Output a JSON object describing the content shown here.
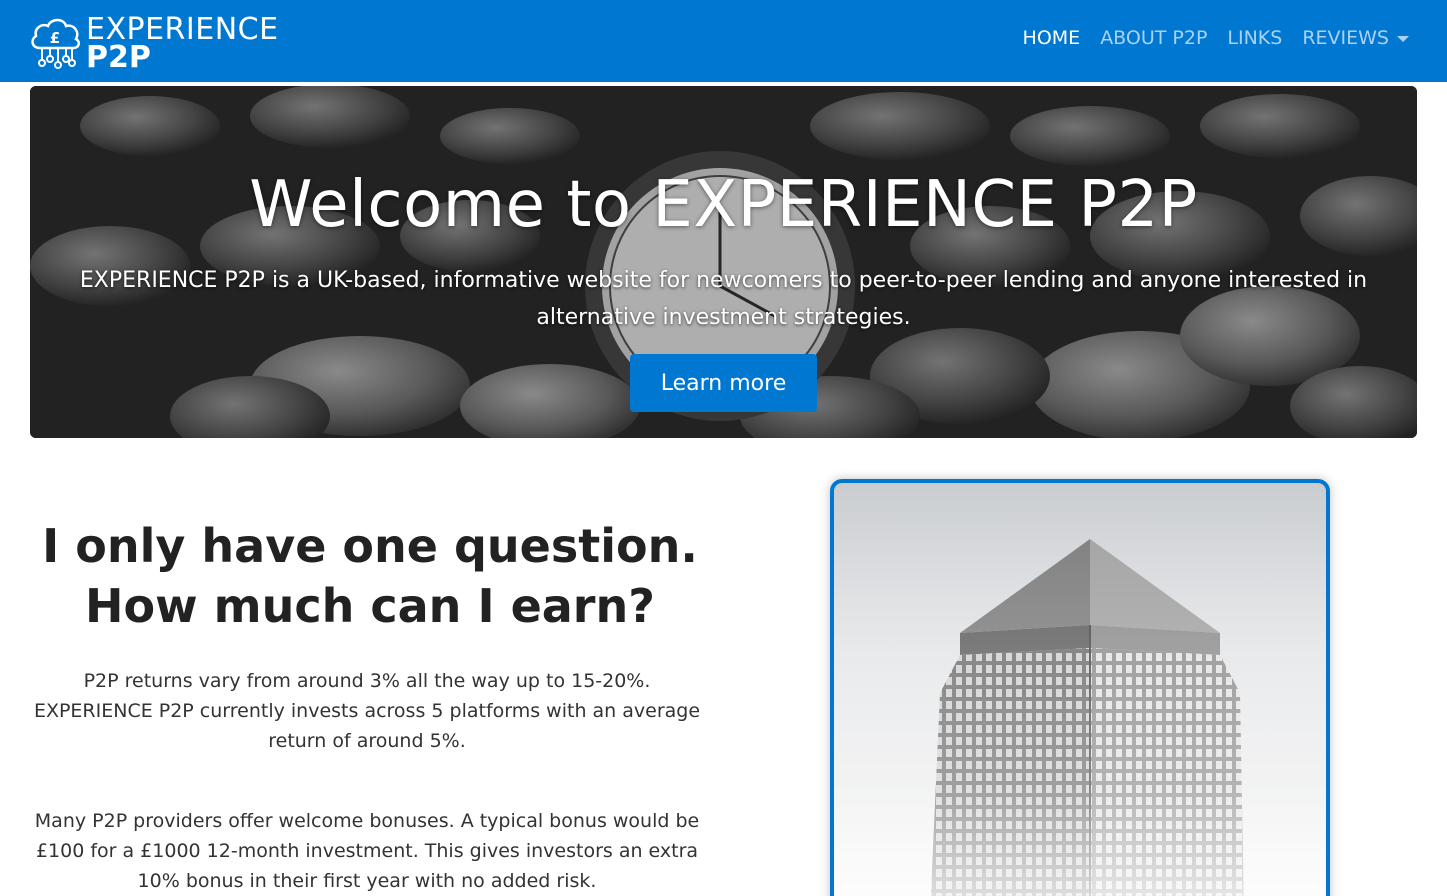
{
  "navbar": {
    "logo": {
      "line1": "EXPERIENCE",
      "line2": "P2P",
      "icon": "cloud-pound-icon"
    },
    "items": [
      {
        "label": "HOME",
        "active": true
      },
      {
        "label": "ABOUT P2P",
        "active": false
      },
      {
        "label": "LINKS",
        "active": false
      },
      {
        "label": "REVIEWS",
        "active": false,
        "dropdown": true
      }
    ],
    "colors": {
      "background": "#0078d2",
      "active": "#ffffff",
      "inactive": "#a9d2f3"
    }
  },
  "hero": {
    "title": "Welcome to EXPERIENCE P2P",
    "subtitle": "EXPERIENCE P2P is a UK-based, informative website for newcomers to peer-to-peer lending and anyone interested in alternative investment strategies.",
    "button_label": "Learn more"
  },
  "section": {
    "heading_line1": "I only have one question.",
    "heading_line2": "How much can I earn?",
    "paragraph1": "P2P returns vary from around 3% all the way up to 15-20%. EXPERIENCE P2P currently invests across 5 platforms with an average return of around 5%.",
    "paragraph2": "Many P2P providers offer welcome bonuses. A typical bonus would be £100 for a £1000 12-month investment. This gives investors an extra 10% bonus in their first year with no added risk."
  },
  "accent_color": "#0078d2"
}
